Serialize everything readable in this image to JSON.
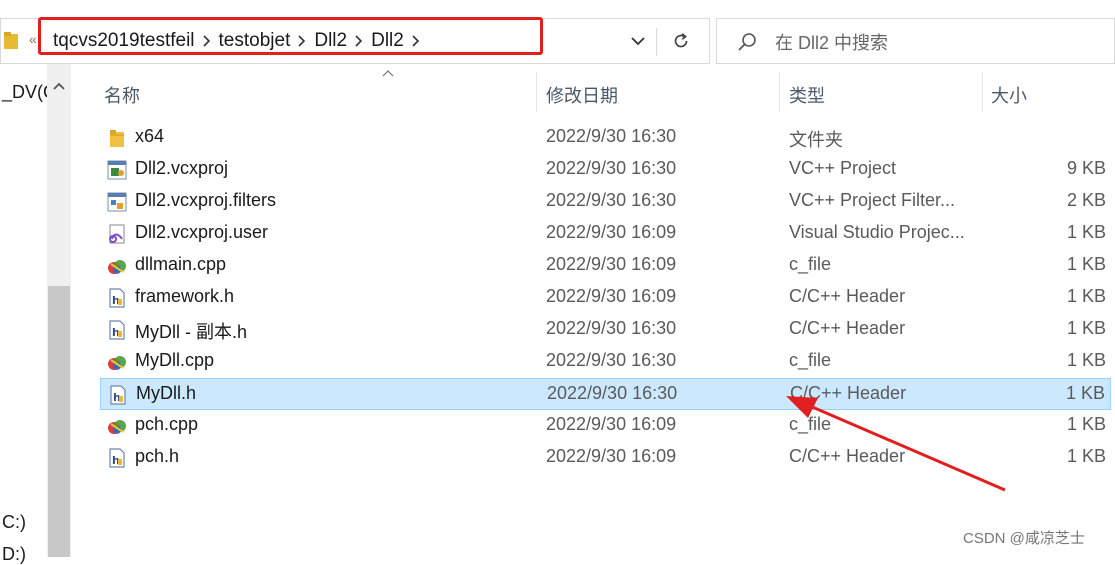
{
  "address": {
    "crumbs": [
      "tqcvs2019testfeil",
      "testobjet",
      "Dll2",
      "Dll2"
    ]
  },
  "search": {
    "placeholder": "在 Dll2 中搜索"
  },
  "nav": {
    "items": [
      "_DV(C",
      "C:)",
      "D:)"
    ]
  },
  "columns": {
    "name": "名称",
    "date": "修改日期",
    "type": "类型",
    "size": "大小"
  },
  "files": [
    {
      "name": "x64",
      "date": "2022/9/30 16:30",
      "type": "文件夹",
      "size": "",
      "icon": "folder-icon"
    },
    {
      "name": "Dll2.vcxproj",
      "date": "2022/9/30 16:30",
      "type": "VC++ Project",
      "size": "9 KB",
      "icon": "vcxproj-icon"
    },
    {
      "name": "Dll2.vcxproj.filters",
      "date": "2022/9/30 16:30",
      "type": "VC++ Project Filter...",
      "size": "2 KB",
      "icon": "vcxproj-filters-icon"
    },
    {
      "name": "Dll2.vcxproj.user",
      "date": "2022/9/30 16:09",
      "type": "Visual Studio Projec...",
      "size": "1 KB",
      "icon": "vs-user-icon"
    },
    {
      "name": "dllmain.cpp",
      "date": "2022/9/30 16:09",
      "type": "c_file",
      "size": "1 KB",
      "icon": "cpp-file-icon"
    },
    {
      "name": "framework.h",
      "date": "2022/9/30 16:09",
      "type": "C/C++ Header",
      "size": "1 KB",
      "icon": "header-file-icon"
    },
    {
      "name": "MyDll - 副本.h",
      "date": "2022/9/30 16:30",
      "type": "C/C++ Header",
      "size": "1 KB",
      "icon": "header-file-icon"
    },
    {
      "name": "MyDll.cpp",
      "date": "2022/9/30 16:30",
      "type": "c_file",
      "size": "1 KB",
      "icon": "cpp-file-icon"
    },
    {
      "name": "MyDll.h",
      "date": "2022/9/30 16:30",
      "type": "C/C++ Header",
      "size": "1 KB",
      "icon": "header-file-icon",
      "selected": true
    },
    {
      "name": "pch.cpp",
      "date": "2022/9/30 16:09",
      "type": "c_file",
      "size": "1 KB",
      "icon": "cpp-file-icon"
    },
    {
      "name": "pch.h",
      "date": "2022/9/30 16:09",
      "type": "C/C++ Header",
      "size": "1 KB",
      "icon": "header-file-icon"
    }
  ],
  "watermark": "CSDN @咸凉芝士",
  "colors": {
    "highlight": "#e02020",
    "selection": "#cce8ff",
    "selection_border": "#99d1ff"
  }
}
